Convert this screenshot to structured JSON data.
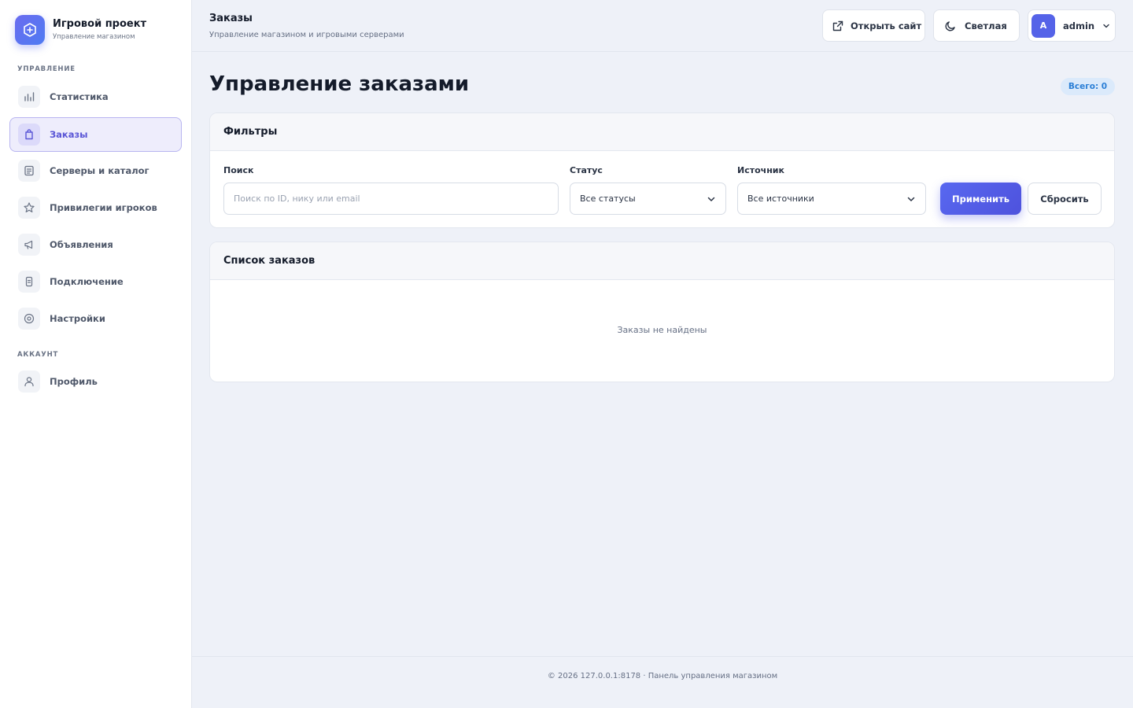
{
  "brand": {
    "title": "Игровой проект",
    "subtitle": "Управление магазином",
    "accent": "#5a63ee"
  },
  "sidebar": {
    "section_manage": "УПРАВЛЕНИЕ",
    "section_account": "АККАУНТ",
    "items": [
      {
        "label": "Статистика",
        "icon": "bar-chart-icon"
      },
      {
        "label": "Заказы",
        "icon": "shopping-bag-icon",
        "active": true
      },
      {
        "label": "Серверы и каталог",
        "icon": "catalog-icon"
      },
      {
        "label": "Привилегии игроков",
        "icon": "star-icon"
      },
      {
        "label": "Объявления",
        "icon": "megaphone-icon"
      },
      {
        "label": "Подключение",
        "icon": "plug-icon"
      },
      {
        "label": "Настройки",
        "icon": "gear-icon"
      }
    ],
    "account_items": [
      {
        "label": "Профиль",
        "icon": "user-icon"
      }
    ]
  },
  "topbar": {
    "title": "Заказы",
    "subtitle": "Управление магазином и игровыми серверами",
    "open_site_label": "Открыть сайт",
    "theme_label": "Светлая",
    "user_initial": "A",
    "user_name": "admin"
  },
  "main": {
    "title": "Управление заказами",
    "total_badge": "Всего: 0",
    "filters": {
      "title": "Фильтры",
      "search_label": "Поиск",
      "search_placeholder": "Поиск по ID, нику или email",
      "search_value": "",
      "status_label": "Статус",
      "status_value": "Все статусы",
      "source_label": "Источник",
      "source_value": "Все источники",
      "apply_label": "Применить",
      "reset_label": "Сбросить"
    },
    "orders": {
      "title": "Список заказов",
      "empty_text": "Заказы не найдены"
    }
  },
  "footer": {
    "text": "© 2026 127.0.0.1:8178 · Панель управления магазином"
  }
}
